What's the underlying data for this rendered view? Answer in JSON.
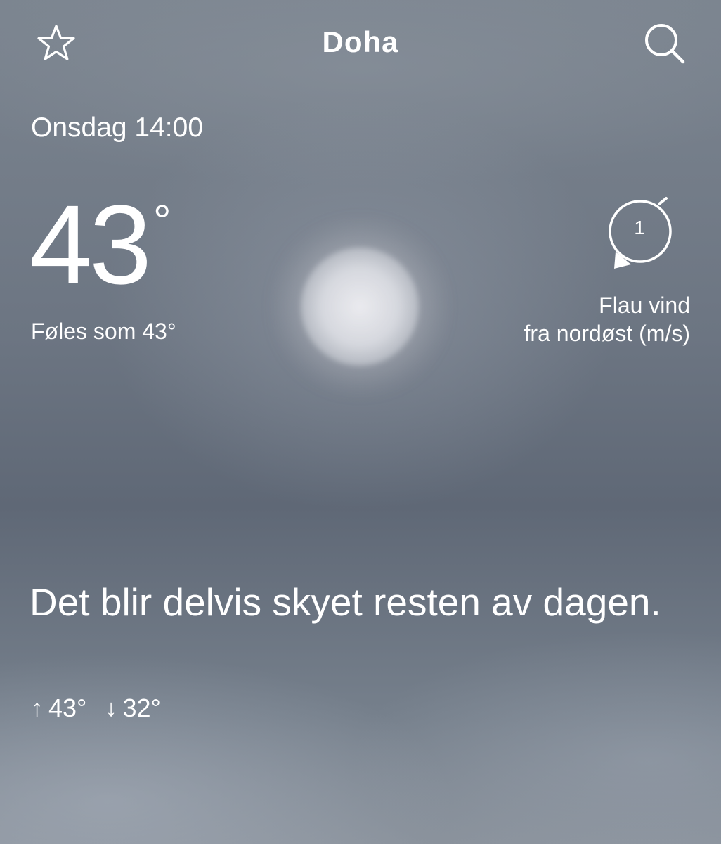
{
  "header": {
    "city": "Doha",
    "favorite_icon": "star-outline-icon",
    "search_icon": "search-icon"
  },
  "current": {
    "datetime": "Onsdag 14:00",
    "temperature": "43",
    "degree_symbol": "°",
    "feels_like": "Føles som 43°",
    "condition_icon": "hazy-sun-icon"
  },
  "wind": {
    "speed": "1",
    "line1": "Flau vind",
    "line2": "fra nordøst (m/s)",
    "direction_icon": "wind-direction-icon"
  },
  "forecast": {
    "summary": "Det blir delvis skyet resten av dagen.",
    "high_arrow": "↑",
    "high": "43°",
    "low_arrow": "↓",
    "low": "32°"
  },
  "colors": {
    "text": "#ffffff",
    "sky": "#6f7885"
  }
}
